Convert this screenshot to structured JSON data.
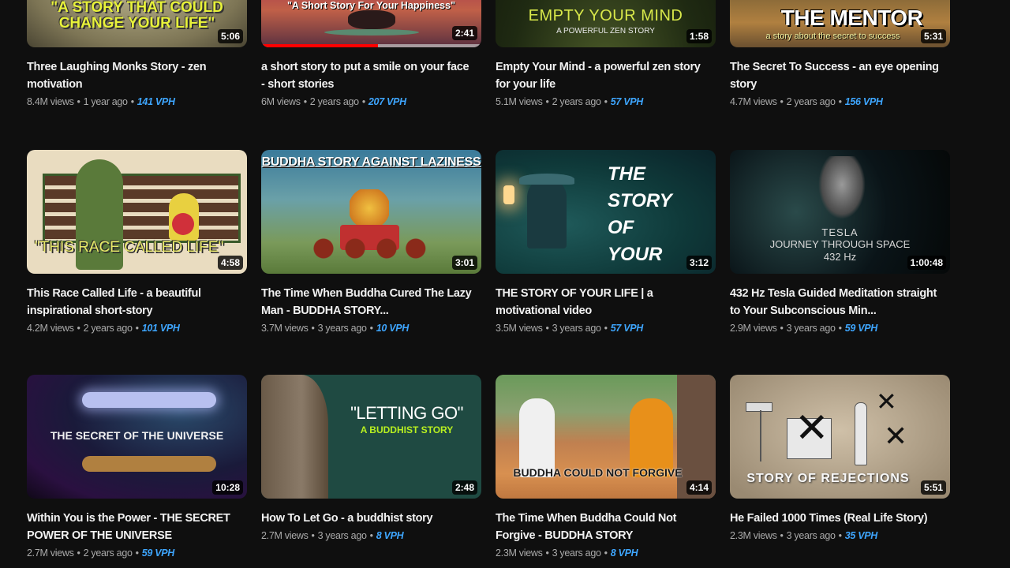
{
  "accent_colors": {
    "vph": "#3ea6ff",
    "progress": "#ff0000",
    "background": "#0f0f0f"
  },
  "videos": [
    {
      "title": "Three Laughing Monks Story - zen motivation",
      "views": "8.4M views",
      "age": "1 year ago",
      "vph": "141 VPH",
      "duration": "5:06",
      "thumb_text": "\"A STORY THAT COULD CHANGE YOUR LIFE\""
    },
    {
      "title": "a short story to put a smile on your face - short stories",
      "views": "6M views",
      "age": "2 years ago",
      "vph": "207 VPH",
      "duration": "2:41",
      "thumb_text": "\"A Short Story For Your Happiness\"",
      "watch_progress": 0.53
    },
    {
      "title": "Empty Your Mind - a powerful zen story for your life",
      "views": "5.1M views",
      "age": "2 years ago",
      "vph": "57 VPH",
      "duration": "1:58",
      "thumb_text": "EMPTY YOUR MIND",
      "thumb_subtext": "A POWERFUL ZEN STORY"
    },
    {
      "title": "The Secret To Success - an eye opening story",
      "views": "4.7M views",
      "age": "2 years ago",
      "vph": "156 VPH",
      "duration": "5:31",
      "thumb_text": "THE MENTOR",
      "thumb_subtext": "a story about the secret to success"
    },
    {
      "title": "This Race Called Life - a beautiful inspirational short-story",
      "views": "4.2M views",
      "age": "2 years ago",
      "vph": "101 VPH",
      "duration": "4:58",
      "thumb_text": "\"THIS RACE CALLED LIFE\""
    },
    {
      "title": "The Time When Buddha Cured The Lazy Man - BUDDHA STORY...",
      "views": "3.7M views",
      "age": "3 years ago",
      "vph": "10 VPH",
      "duration": "3:01",
      "thumb_text": "BUDDHA STORY AGAINST LAZINESS"
    },
    {
      "title": "THE STORY OF YOUR LIFE | a motivational video",
      "views": "3.5M views",
      "age": "3 years ago",
      "vph": "57 VPH",
      "duration": "3:12",
      "thumb_text": "THE STORY OF YOUR LIFE"
    },
    {
      "title": "432 Hz Tesla Guided Meditation straight to Your Subconscious Min...",
      "views": "2.9M views",
      "age": "3 years ago",
      "vph": "59 VPH",
      "duration": "1:00:48",
      "thumb_text": "TESLA",
      "thumb_subtext": "JOURNEY THROUGH SPACE 432 Hz"
    },
    {
      "title": "Within You is the Power - THE SECRET POWER OF THE UNIVERSE",
      "views": "2.7M views",
      "age": "2 years ago",
      "vph": "59 VPH",
      "duration": "10:28",
      "thumb_text": "THE SECRET OF THE UNIVERSE"
    },
    {
      "title": "How To Let Go - a buddhist story",
      "views": "2.7M views",
      "age": "3 years ago",
      "vph": "8 VPH",
      "duration": "2:48",
      "thumb_text": "\"LETTING GO\"",
      "thumb_subtext": "A BUDDHIST STORY"
    },
    {
      "title": "The Time When Buddha Could Not Forgive - BUDDHA STORY",
      "views": "2.3M views",
      "age": "3 years ago",
      "vph": "8 VPH",
      "duration": "4:14",
      "thumb_text": "BUDDHA COULD NOT FORGIVE"
    },
    {
      "title": "He Failed 1000 Times (Real Life Story)",
      "views": "2.3M views",
      "age": "3 years ago",
      "vph": "35 VPH",
      "duration": "5:51",
      "thumb_text": "STORY OF REJECTIONS"
    }
  ],
  "separator": "•"
}
